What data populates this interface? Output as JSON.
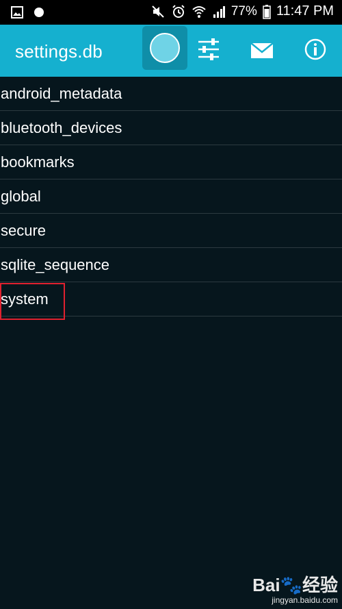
{
  "status_bar": {
    "battery": "77%",
    "time": "11:47 PM",
    "icons": [
      "gallery-icon",
      "circle-icon",
      "mute-icon",
      "alarm-icon",
      "wifi-icon",
      "signal-icon",
      "battery-icon"
    ]
  },
  "app_bar": {
    "title": "settings.db",
    "actions": [
      "record-icon",
      "sliders-icon",
      "mail-icon",
      "info-icon"
    ],
    "color": "#15b0cf"
  },
  "tables": [
    {
      "name": "android_metadata"
    },
    {
      "name": "bluetooth_devices"
    },
    {
      "name": "bookmarks"
    },
    {
      "name": "global"
    },
    {
      "name": "secure"
    },
    {
      "name": "sqlite_sequence"
    },
    {
      "name": "system"
    }
  ],
  "highlighted_item": "system",
  "watermark": {
    "logo": "Bai",
    "logo_tail": "经验",
    "url": "jingyan.baidu.com"
  }
}
